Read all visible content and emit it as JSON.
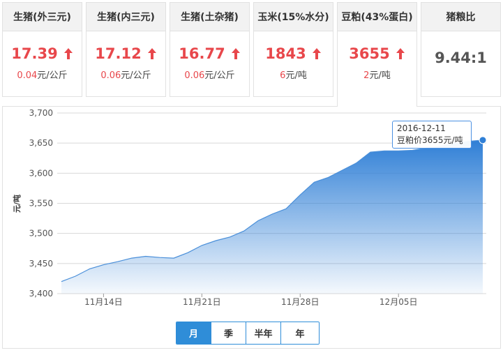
{
  "cards": [
    {
      "title": "生猪(外三元)",
      "price": "17.39",
      "change_num": "0.04",
      "change_unit": "元/公斤",
      "trend": "up"
    },
    {
      "title": "生猪(内三元)",
      "price": "17.12",
      "change_num": "0.06",
      "change_unit": "元/公斤",
      "trend": "up"
    },
    {
      "title": "生猪(土杂猪)",
      "price": "16.77",
      "change_num": "0.06",
      "change_unit": "元/公斤",
      "trend": "up"
    },
    {
      "title": "玉米(15%水分)",
      "price": "1843",
      "change_num": "6",
      "change_unit": "元/吨",
      "trend": "up"
    },
    {
      "title": "豆粕(43%蛋白)",
      "price": "3655",
      "change_num": "2",
      "change_unit": "元/吨",
      "trend": "up"
    },
    {
      "title": "猪粮比",
      "ratio": "9.44:1"
    }
  ],
  "tooltip": {
    "date": "2016-12-11",
    "text": "豆粕价3655元/吨"
  },
  "range_buttons": [
    {
      "label": "月",
      "active": true
    },
    {
      "label": "季",
      "active": false
    },
    {
      "label": "半年",
      "active": false
    },
    {
      "label": "年",
      "active": false
    }
  ],
  "colors": {
    "accent": "#2f8dd8",
    "up": "#e8474b",
    "line": "#4a8fd9"
  },
  "chart_data": {
    "type": "area",
    "ylabel": "元/吨",
    "xlabel": "",
    "ylim": [
      3400,
      3700
    ],
    "yticks": [
      "3,400",
      "3,450",
      "3,500",
      "3,550",
      "3,600",
      "3,650",
      "3,700"
    ],
    "xticks": [
      "11月14日",
      "11月21日",
      "11月28日",
      "12月05日"
    ],
    "x": [
      "2016-11-11",
      "2016-11-12",
      "2016-11-13",
      "2016-11-14",
      "2016-11-15",
      "2016-11-16",
      "2016-11-17",
      "2016-11-18",
      "2016-11-19",
      "2016-11-20",
      "2016-11-21",
      "2016-11-22",
      "2016-11-23",
      "2016-11-24",
      "2016-11-25",
      "2016-11-26",
      "2016-11-27",
      "2016-11-28",
      "2016-11-29",
      "2016-11-30",
      "2016-12-01",
      "2016-12-02",
      "2016-12-03",
      "2016-12-04",
      "2016-12-05",
      "2016-12-06",
      "2016-12-07",
      "2016-12-08",
      "2016-12-09",
      "2016-12-10",
      "2016-12-11"
    ],
    "series": [
      {
        "values": [
          3420,
          3429,
          3441,
          3448,
          3453,
          3459,
          3462,
          3460,
          3459,
          3468,
          3480,
          3488,
          3494,
          3504,
          3521,
          3532,
          3541,
          3564,
          3585,
          3593,
          3605,
          3617,
          3635,
          3637,
          3637,
          3638,
          3642,
          3645,
          3650,
          3653,
          3655
        ]
      }
    ],
    "grid": true,
    "legend": "none"
  }
}
